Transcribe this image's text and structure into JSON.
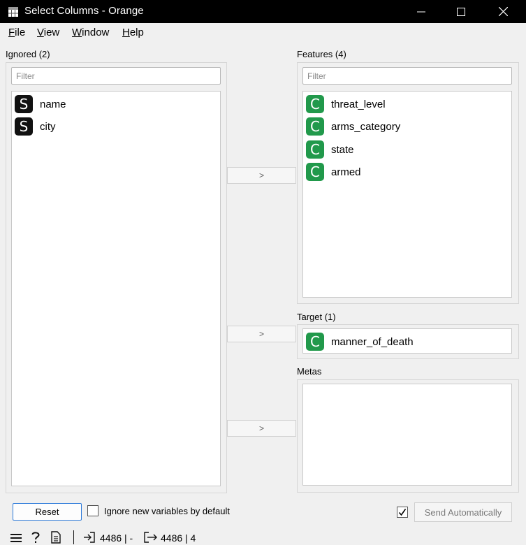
{
  "window": {
    "title": "Select Columns - Orange"
  },
  "menu": [
    {
      "label": "File",
      "mnemonic": "F",
      "rest": "ile"
    },
    {
      "label": "View",
      "mnemonic": "V",
      "rest": "iew"
    },
    {
      "label": "Window",
      "mnemonic": "W",
      "rest": "indow"
    },
    {
      "label": "Help",
      "mnemonic": "H",
      "rest": "elp"
    }
  ],
  "ignored": {
    "title": "Ignored (2)",
    "filter_placeholder": "Filter",
    "items": [
      {
        "type": "S",
        "name": "name"
      },
      {
        "type": "S",
        "name": "city"
      }
    ]
  },
  "features": {
    "title": "Features (4)",
    "filter_placeholder": "Filter",
    "items": [
      {
        "type": "C",
        "name": "threat_level"
      },
      {
        "type": "C",
        "name": "arms_category"
      },
      {
        "type": "C",
        "name": "state"
      },
      {
        "type": "C",
        "name": "armed"
      }
    ]
  },
  "target": {
    "title": "Target (1)",
    "items": [
      {
        "type": "C",
        "name": "manner_of_death"
      }
    ]
  },
  "metas": {
    "title": "Metas"
  },
  "move_buttons": {
    "features": ">",
    "target": ">",
    "metas": ">"
  },
  "controls": {
    "reset_label": "Reset",
    "ignore_new_label": "Ignore new variables by default",
    "ignore_new_checked": false,
    "auto_send_checked": true,
    "send_label": "Send Automatically"
  },
  "status": {
    "input_text": "4486 | -",
    "output_text": "4486 | 4"
  },
  "colors": {
    "categorical": "#21994b",
    "string": "#111111",
    "focus_border": "#2b79d9"
  },
  "icons": {
    "app": "orange-app-icon",
    "minimize": "minimize-icon",
    "maximize": "maximize-icon",
    "close": "close-icon",
    "menu": "hamburger-menu-icon",
    "help": "help-icon",
    "report": "report-icon",
    "input": "input-arrow-icon",
    "output": "output-arrow-icon"
  }
}
